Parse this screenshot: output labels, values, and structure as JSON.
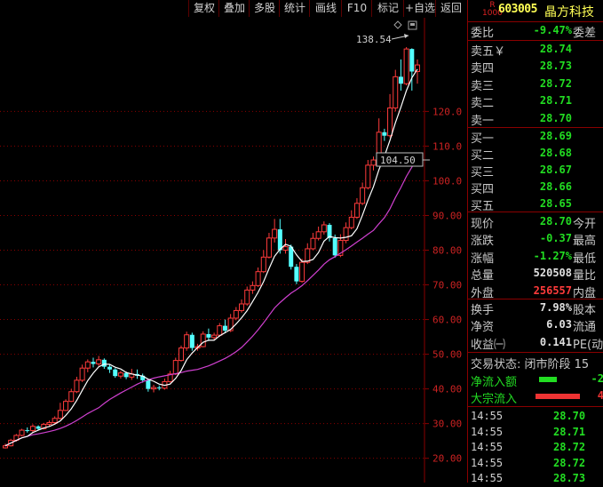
{
  "toolbar": {
    "buttons": [
      "复权",
      "叠加",
      "多股",
      "统计",
      "画线",
      "F10",
      "标记",
      "+自选",
      "返回"
    ]
  },
  "chart": {
    "y_ticks": [
      "120.0",
      "110.0",
      "100.0",
      "90.00",
      "80.00",
      "70.00",
      "60.00",
      "50.00",
      "40.00",
      "30.00",
      "20.00"
    ],
    "max_label": "138.54",
    "price_tag": "104.50"
  },
  "chart_data": {
    "type": "candlestick",
    "ylim": [
      13,
      147
    ],
    "candles": [
      [
        23.0,
        23.6,
        22.8,
        24.2
      ],
      [
        23.6,
        25.2,
        23.4,
        25.6
      ],
      [
        25.2,
        26.6,
        24.8,
        27.0
      ],
      [
        26.6,
        28.1,
        26.3,
        28.5
      ],
      [
        28.1,
        28.0,
        27.4,
        28.9
      ],
      [
        28.0,
        29.2,
        27.6,
        29.8
      ],
      [
        29.2,
        28.5,
        28.1,
        29.5
      ],
      [
        28.5,
        29.8,
        28.3,
        30.2
      ],
      [
        29.8,
        30.3,
        29.3,
        30.9
      ],
      [
        30.3,
        31.5,
        30.0,
        32.1
      ],
      [
        31.5,
        33.8,
        31.2,
        36.0
      ],
      [
        33.8,
        36.4,
        33.6,
        37.0
      ],
      [
        36.4,
        39.2,
        36.2,
        40.0
      ],
      [
        39.2,
        42.5,
        38.8,
        43.5
      ],
      [
        42.5,
        46.0,
        42.0,
        47.0
      ],
      [
        46.0,
        47.8,
        44.8,
        48.5
      ],
      [
        47.8,
        47.2,
        46.2,
        49.0
      ],
      [
        47.2,
        48.4,
        46.6,
        49.5
      ],
      [
        48.4,
        46.4,
        45.8,
        48.8
      ],
      [
        46.4,
        45.6,
        44.6,
        47.2
      ],
      [
        45.6,
        43.7,
        43.2,
        46.0
      ],
      [
        43.7,
        44.6,
        43.0,
        45.2
      ],
      [
        44.6,
        43.4,
        42.8,
        45.0
      ],
      [
        43.4,
        44.3,
        42.6,
        45.8
      ],
      [
        44.3,
        43.8,
        42.9,
        45.6
      ],
      [
        43.8,
        42.5,
        41.8,
        44.4
      ],
      [
        42.5,
        40.0,
        39.2,
        42.8
      ],
      [
        40.0,
        40.4,
        39.0,
        41.2
      ],
      [
        40.4,
        40.2,
        39.6,
        41.0
      ],
      [
        40.2,
        42.1,
        39.8,
        43.0
      ],
      [
        42.1,
        44.3,
        41.8,
        45.2
      ],
      [
        44.3,
        48.2,
        44.0,
        49.0
      ],
      [
        48.2,
        51.8,
        47.9,
        52.5
      ],
      [
        51.8,
        55.6,
        51.0,
        56.5
      ],
      [
        55.6,
        51.8,
        51.0,
        56.2
      ],
      [
        51.8,
        52.2,
        51.0,
        53.0
      ],
      [
        52.2,
        55.8,
        52.0,
        56.6
      ],
      [
        55.8,
        54.8,
        53.8,
        57.4
      ],
      [
        54.8,
        55.5,
        54.2,
        56.2
      ],
      [
        55.5,
        58.2,
        55.0,
        59.0
      ],
      [
        58.2,
        56.8,
        56.2,
        60.0
      ],
      [
        56.8,
        60.4,
        56.4,
        61.6
      ],
      [
        60.4,
        62.6,
        59.8,
        63.6
      ],
      [
        62.6,
        64.5,
        62.0,
        65.8
      ],
      [
        64.5,
        68.5,
        64.0,
        69.5
      ],
      [
        68.5,
        69.8,
        67.4,
        71.0
      ],
      [
        69.8,
        73.8,
        69.4,
        75.0
      ],
      [
        73.8,
        78.0,
        73.4,
        80.0
      ],
      [
        78.0,
        83.5,
        77.6,
        85.0
      ],
      [
        83.5,
        86.0,
        82.2,
        89.0
      ],
      [
        86.0,
        80.0,
        79.0,
        89.0
      ],
      [
        80.0,
        81.0,
        79.0,
        83.2
      ],
      [
        81.0,
        75.2,
        74.4,
        81.6
      ],
      [
        75.2,
        71.0,
        70.2,
        76.0
      ],
      [
        71.0,
        76.5,
        70.6,
        77.5
      ],
      [
        76.5,
        80.4,
        76.0,
        82.0
      ],
      [
        80.4,
        83.4,
        80.0,
        85.0
      ],
      [
        83.4,
        85.3,
        82.8,
        86.8
      ],
      [
        85.3,
        87.3,
        84.5,
        88.3
      ],
      [
        87.3,
        83.5,
        82.5,
        87.8
      ],
      [
        83.5,
        78.5,
        77.8,
        84.5
      ],
      [
        78.5,
        82.8,
        78.0,
        84.6
      ],
      [
        82.8,
        86.5,
        82.0,
        88.0
      ],
      [
        86.5,
        89.5,
        86.0,
        91.5
      ],
      [
        89.5,
        93.5,
        89.0,
        95.0
      ],
      [
        93.5,
        98.0,
        93.0,
        99.5
      ],
      [
        98.0,
        104.5,
        97.5,
        106.0
      ],
      [
        104.5,
        106.0,
        103.0,
        107.0
      ],
      [
        106.0,
        114.0,
        105.5,
        118.0
      ],
      [
        114.0,
        113.0,
        111.5,
        115.0
      ],
      [
        113.0,
        121.0,
        112.5,
        125.0
      ],
      [
        121.0,
        130.0,
        120.0,
        132.0
      ],
      [
        130.0,
        128.0,
        126.0,
        135.0
      ],
      [
        128.0,
        138.0,
        127.5,
        138.54
      ],
      [
        138.0,
        131.5,
        126.0,
        138.2
      ],
      [
        131.5,
        133.4,
        128.0,
        135.0
      ]
    ]
  },
  "panel": {
    "badge_top": "R",
    "badge_bottom": "1000",
    "code": "603005",
    "name": "晶方科技",
    "weibi": {
      "label": "委比",
      "value": "-9.47%",
      "right": "委差"
    },
    "asks": [
      {
        "label": "卖五￥",
        "price": "28.74"
      },
      {
        "label": "卖四",
        "price": "28.73"
      },
      {
        "label": "卖三",
        "price": "28.72"
      },
      {
        "label": "卖二",
        "price": "28.71"
      },
      {
        "label": "卖一",
        "price": "28.70"
      }
    ],
    "bids": [
      {
        "label": "买一",
        "price": "28.69"
      },
      {
        "label": "买二",
        "price": "28.68"
      },
      {
        "label": "买三",
        "price": "28.67"
      },
      {
        "label": "买四",
        "price": "28.66"
      },
      {
        "label": "买五",
        "price": "28.65"
      }
    ],
    "stats": [
      {
        "label": "现价",
        "value": "28.70",
        "right": "今开",
        "color": "green"
      },
      {
        "label": "涨跌",
        "value": "-0.37",
        "right": "最高",
        "color": "green"
      },
      {
        "label": "涨幅",
        "value": "-1.27%",
        "right": "最低",
        "color": "green"
      },
      {
        "label": "总量",
        "value": "520508",
        "right": "量比",
        "color": "white"
      },
      {
        "label": "外盘",
        "value": "256557",
        "right": "内盘",
        "color": "red"
      }
    ],
    "stats2": [
      {
        "label": "换手",
        "value": "7.98%",
        "right": "股本"
      },
      {
        "label": "净资",
        "value": "6.03",
        "right": "流通"
      },
      {
        "label": "收益㈠",
        "value": "0.141",
        "right": "PE(动"
      }
    ],
    "trade_status": "交易状态: 闭市阶段 15",
    "flows": [
      {
        "label": "净流入额",
        "value": "-2",
        "bar_color": "#22dd22"
      },
      {
        "label": "大宗流入",
        "value": "4",
        "bar_color": "#ee3333"
      }
    ],
    "ticks": [
      {
        "time": "14:55",
        "price": "28.70"
      },
      {
        "time": "14:55",
        "price": "28.71"
      },
      {
        "time": "14:55",
        "price": "28.72"
      },
      {
        "time": "14:55",
        "price": "28.72"
      },
      {
        "time": "14:55",
        "price": "28.73"
      }
    ]
  },
  "colors": {
    "up": "#ff3b3b",
    "down": "#54ffff",
    "ma_short": "#ffffff",
    "ma_long": "#d040d0",
    "grid": "#8a0000"
  }
}
